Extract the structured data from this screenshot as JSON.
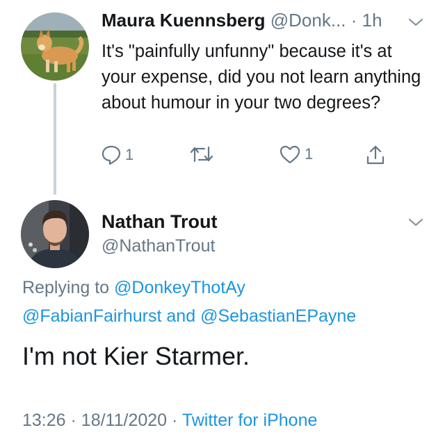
{
  "parent_tweet": {
    "author_name": "Maura Kuennsberg",
    "author_handle": "@Donk...",
    "separator": "·",
    "time": "1h",
    "text": "It's \"painfully unfunny\" because it's at your expense, did you not learn anything about humour in your two degrees?",
    "reply_count": "1",
    "like_count": "1",
    "icons": [
      "reply-icon",
      "retweet-icon",
      "like-icon",
      "share-icon",
      "chevron-down-icon"
    ]
  },
  "main_tweet": {
    "author_name": "Nathan Trout",
    "author_handle": "@NathanTrout",
    "replying_prefix": "Replying to",
    "replying_to_1": "@DonkeyThotAy",
    "replying_to_2": "@FabianFairhurst",
    "replying_and": "and",
    "replying_to_3": "@SebastianEPayne",
    "text": "I'm not Kier Starmer.",
    "time": "13:26",
    "separator": "·",
    "date": "18/11/2020",
    "source": "Twitter for iPhone"
  },
  "colors": {
    "link": "#1b95e0",
    "secondary_text": "#657786",
    "thread_line": "#c9d1d8"
  }
}
